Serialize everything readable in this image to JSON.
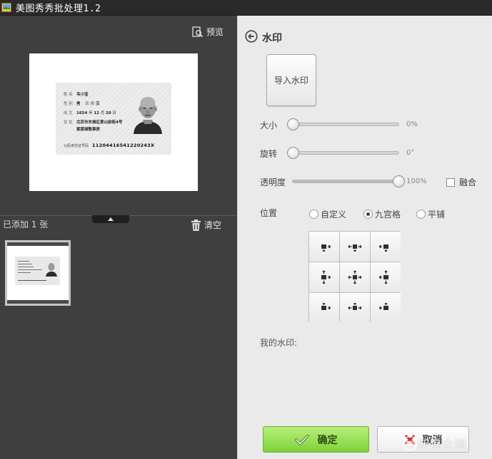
{
  "window": {
    "title": "美图秀秀批处理1.2"
  },
  "left_panel": {
    "preview_label": "预览",
    "added_count": "已添加 1 张",
    "clear_label": "清空",
    "id_card": {
      "name_label": "姓 名",
      "name_value": "韦小宝",
      "sex_label": "性 别",
      "sex_value": "男",
      "ethnic_label": "民 族",
      "ethnic_value": "汉",
      "birth_label": "出 生",
      "birth_year": "1654",
      "year_char": "年",
      "birth_month": "12",
      "month_char": "月",
      "birth_day": "20",
      "day_char": "日",
      "address_label": "住 址",
      "address_line1": "北京市东城区景山前街4号",
      "address_line2": "紫禁城敬事房",
      "id_label": "公民身份证号码",
      "id_number": "11204416541220243X"
    }
  },
  "right_panel": {
    "title": "水印",
    "import_label": "导入水印",
    "size_label": "大小",
    "size_value": "0%",
    "size_level": 0,
    "rotate_label": "旋转",
    "rotate_value": "0°",
    "rotate_level": 0,
    "opacity_label": "透明度",
    "opacity_value": "100%",
    "opacity_level": 100,
    "blend_label": "融合",
    "position_label": "位置",
    "position_options": [
      "自定义",
      "九宫格",
      "平铺"
    ],
    "position_selected": "九宫格",
    "my_watermark_label": "我的水印:",
    "ok_label": "确定",
    "cancel_label": "取消"
  },
  "colors": {
    "accent_green": "#7ed23c",
    "dark_bg": "#3f3f3f",
    "panel_bg": "#eaeaea"
  },
  "watermark_site": "新浪众测"
}
